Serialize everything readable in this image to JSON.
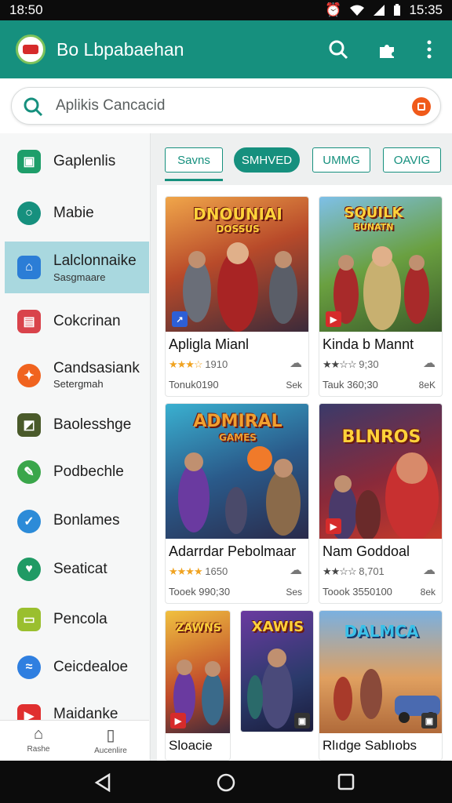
{
  "status_bar": {
    "time_left": "18:50",
    "time_right": "15:35"
  },
  "app_bar": {
    "title": "Bo Lbpabaehan"
  },
  "search": {
    "placeholder": "Aplikis Cancacid"
  },
  "sidebar": {
    "items": [
      {
        "label": "Gaplenlis",
        "sub": "",
        "icon": "calendar-icon",
        "color": "#1e9e6a"
      },
      {
        "label": "Mabie",
        "sub": "",
        "icon": "search-icon",
        "color": "#16907e"
      },
      {
        "label": "Lalclonnaike",
        "sub": "Sasgmaare",
        "icon": "house-icon",
        "color": "#2b7dd6"
      },
      {
        "label": "Cokcrinan",
        "sub": "",
        "icon": "image-icon",
        "color": "#d9434b"
      },
      {
        "label": "Candsasiank",
        "sub": "Setergmah",
        "icon": "flame-icon",
        "color": "#f0631f"
      },
      {
        "label": "Baolesshge",
        "sub": "",
        "icon": "leaf-icon",
        "color": "#4a5a2a"
      },
      {
        "label": "Podbechle",
        "sub": "",
        "icon": "chat-icon",
        "color": "#3aa64a"
      },
      {
        "label": "Bonlames",
        "sub": "",
        "icon": "check-icon",
        "color": "#2c8bd8"
      },
      {
        "label": "Seaticat",
        "sub": "",
        "icon": "heart-icon",
        "color": "#1f9a64"
      },
      {
        "label": "Pencola",
        "sub": "",
        "icon": "folder-icon",
        "color": "#9abf2e"
      },
      {
        "label": "Ceicdealoe",
        "sub": "",
        "icon": "messenger-icon",
        "color": "#2f7fe0"
      },
      {
        "label": "Maidanke",
        "sub": "",
        "icon": "play-icon",
        "color": "#e02f2f"
      }
    ],
    "bottom_tabs": [
      {
        "label": "Rashe",
        "icon": "home-icon"
      },
      {
        "label": "Aucenlire",
        "icon": "clipboard-icon"
      }
    ]
  },
  "tabs": [
    {
      "label": "Savns",
      "style": "selected-outline"
    },
    {
      "label": "SMHVED",
      "style": "filled"
    },
    {
      "label": "UMMG",
      "style": "outline"
    },
    {
      "label": "OAVIG",
      "style": "outline"
    }
  ],
  "cards": [
    {
      "art_title": "DNOUNIAI",
      "art_subtitle": "DOSSUS",
      "name": "Apligla Mianl",
      "stars": "★★★☆",
      "rating": "1910",
      "meta": "Tonuk0190",
      "size": "Sek",
      "badge": "↗",
      "badge_color": "#2d5fd6"
    },
    {
      "art_title": "SQUILK",
      "art_subtitle": "BUNATN",
      "name": "Kinda b Mannt",
      "stars": "★★☆☆",
      "rating": "9;30",
      "meta": "Tauk 360;30",
      "size": "8eK",
      "badge": "▶",
      "badge_color": "#d62b2b"
    },
    {
      "art_title": "ADMIRAL",
      "art_subtitle": "GAMES",
      "name": "Adarrdar Pebolmaar",
      "stars": "★★★★",
      "rating": "1650",
      "meta": "Tooek 990;30",
      "size": "Ses",
      "badge": "",
      "badge_color": ""
    },
    {
      "art_title": "BLNROS",
      "art_subtitle": "",
      "name": "Nam Goddoal",
      "stars": "★★☆☆",
      "rating": "8,701",
      "meta": "Toook 3550100",
      "size": "8ek",
      "badge": "▶",
      "badge_color": "#d62b2b"
    },
    {
      "art_title": "ZAWNS",
      "art_subtitle": "",
      "name": "Sloacie",
      "stars": "",
      "rating": "",
      "meta": "",
      "size": "",
      "badge": "▶",
      "badge_color": "#d62b2b"
    },
    {
      "art_title": "XAWIS",
      "art_subtitle": "",
      "name": "",
      "stars": "",
      "rating": "",
      "meta": "",
      "size": "",
      "badge": "▣",
      "badge_color": "#333"
    },
    {
      "art_title": "DALMCA",
      "art_subtitle": "",
      "name": "Rlıdge Sablıobs",
      "stars": "",
      "rating": "",
      "meta": "",
      "size": "",
      "badge": "▣",
      "badge_color": "#333"
    }
  ]
}
